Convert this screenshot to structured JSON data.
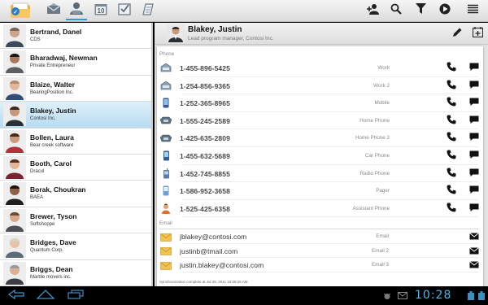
{
  "toolbar": {
    "tabs": [
      {
        "icon": "mail-icon"
      },
      {
        "icon": "contacts-icon",
        "active": true
      },
      {
        "icon": "calendar-icon",
        "text": "10"
      },
      {
        "icon": "tasks-icon"
      },
      {
        "icon": "notes-icon"
      }
    ],
    "actions": [
      "add-contact-icon",
      "search-icon",
      "filter-icon",
      "play-icon",
      "menu-icon"
    ]
  },
  "contacts": [
    {
      "name": "Bertrand, Danel",
      "company": "CDS"
    },
    {
      "name": "Bharadwaj, Newman",
      "company": "Private Entrepreneur"
    },
    {
      "name": "Blaize, Walter",
      "company": "BearingPosition Inc."
    },
    {
      "name": "Blakey, Justin",
      "company": "Contosi Inc.",
      "selected": true
    },
    {
      "name": "Bollen, Laura",
      "company": "Bear creek software"
    },
    {
      "name": "Booth, Carol",
      "company": "Dracul"
    },
    {
      "name": "Borak, Choukran",
      "company": "BAEA"
    },
    {
      "name": "Brewer, Tyson",
      "company": "Softshoppe"
    },
    {
      "name": "Bridges, Dave",
      "company": "Quantum Corp."
    },
    {
      "name": "Briggs, Dean",
      "company": "Marble movers inc."
    }
  ],
  "detail": {
    "name": "Blakey, Justin",
    "title": "Lead program manager, Contosi Inc.",
    "phone_section": "Phone",
    "phones": [
      {
        "number": "1-455-896-5425",
        "type": "Work",
        "icon": "work-phone-icon"
      },
      {
        "number": "1-254-856-9365",
        "type": "Work 2",
        "icon": "work-phone-icon"
      },
      {
        "number": "1-252-365-8965",
        "type": "Mobile",
        "icon": "mobile-phone-icon"
      },
      {
        "number": "1-555-245-2589",
        "type": "Home Phone",
        "icon": "home-phone-icon"
      },
      {
        "number": "1-425-635-2809",
        "type": "Home Phone 2",
        "icon": "home-phone-icon"
      },
      {
        "number": "1-455-632-5689",
        "type": "Car Phone",
        "icon": "car-phone-icon"
      },
      {
        "number": "1-452-745-8855",
        "type": "Radio Phone",
        "icon": "radio-phone-icon"
      },
      {
        "number": "1-586-952-3658",
        "type": "Pager",
        "icon": "pager-icon"
      },
      {
        "number": "1-525-425-6358",
        "type": "Assistant Phone",
        "icon": "assistant-phone-icon"
      }
    ],
    "email_section": "Email",
    "emails": [
      {
        "address": "jblakey@contosi.com",
        "type": "Email"
      },
      {
        "address": "justinb@tmail.com",
        "type": "Email 2"
      },
      {
        "address": "justin.blakey@contosi.com",
        "type": "Email 3"
      }
    ]
  },
  "status": {
    "sync": "Synchronization complete    at Jul 28, 2011 10:28:25 AM",
    "clock": "10:28"
  },
  "colors": {
    "accent": "#2d9ad6",
    "selected_row": "#b7dbf1",
    "clock": "#49b6ef"
  }
}
